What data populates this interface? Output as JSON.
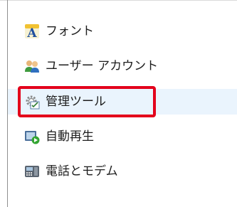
{
  "control_panel_items": [
    {
      "label": "フォント",
      "icon": "font-icon"
    },
    {
      "label": "ユーザー アカウント",
      "icon": "user-accounts-icon"
    },
    {
      "label": "管理ツール",
      "icon": "administrative-tools-icon",
      "state": "hovered",
      "callout": "red-outline"
    },
    {
      "label": "自動再生",
      "icon": "autoplay-icon"
    },
    {
      "label": "電話とモデム",
      "icon": "phone-modem-icon"
    }
  ],
  "colors": {
    "callout": "#e3001b",
    "hover_background": "#eaf4fd",
    "text": "#1d1d1d"
  }
}
